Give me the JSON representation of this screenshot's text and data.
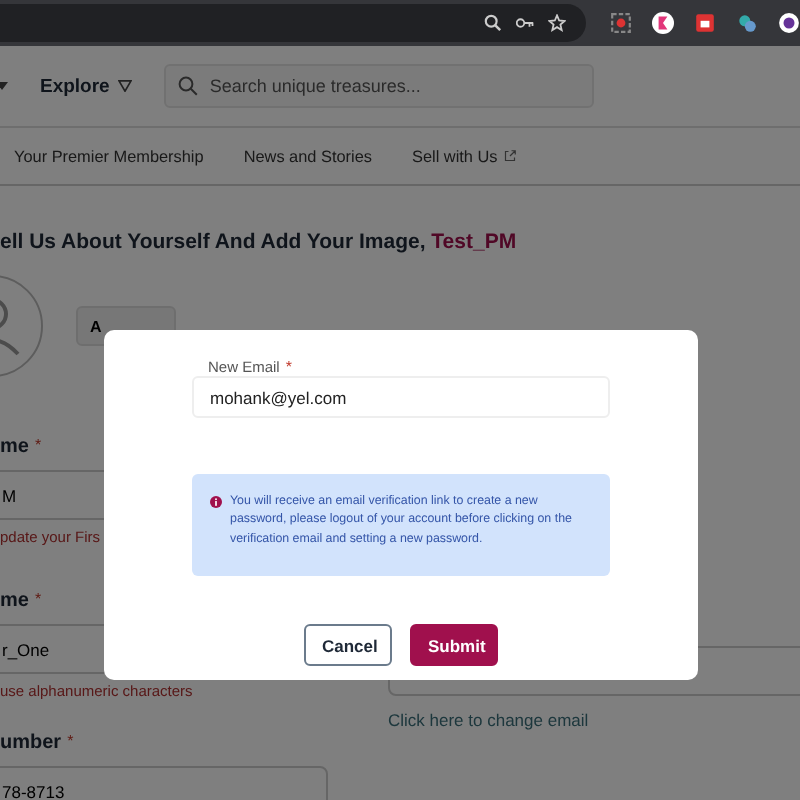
{
  "header": {
    "explore": "Explore",
    "search": {
      "placeholder": "Search unique treasures..."
    }
  },
  "nav": [
    {
      "label": "Your Premier Membership",
      "external": false
    },
    {
      "label": "News and Stories",
      "external": false
    },
    {
      "label": "Sell with Us",
      "external": true
    }
  ],
  "profile": {
    "heading": "ell Us About Yourself And Add Your Image, ",
    "username": "Test_PM",
    "photo_button": "A"
  },
  "fields": [
    {
      "label": "me",
      "required_mark": "*",
      "value": "M",
      "error": "pdate your Firs"
    },
    {
      "label": "me",
      "required_mark": "*",
      "value": "r_One",
      "error": "use alphanumeric characters"
    },
    {
      "label": "umber",
      "required_mark": "*",
      "value": "78-8713"
    }
  ],
  "email_section": {
    "link": "Click here to change email"
  },
  "dialog": {
    "field": {
      "label": "New Email",
      "required_mark": "*",
      "value": "mohank@yel.com"
    },
    "info": "You will receive an email verification link to create a new password, please logout of your account before clicking on the verification email and setting a new password.",
    "buttons": [
      {
        "label": "Cancel",
        "kind": "secondary"
      },
      {
        "label": "Submit",
        "kind": "primary"
      }
    ]
  }
}
